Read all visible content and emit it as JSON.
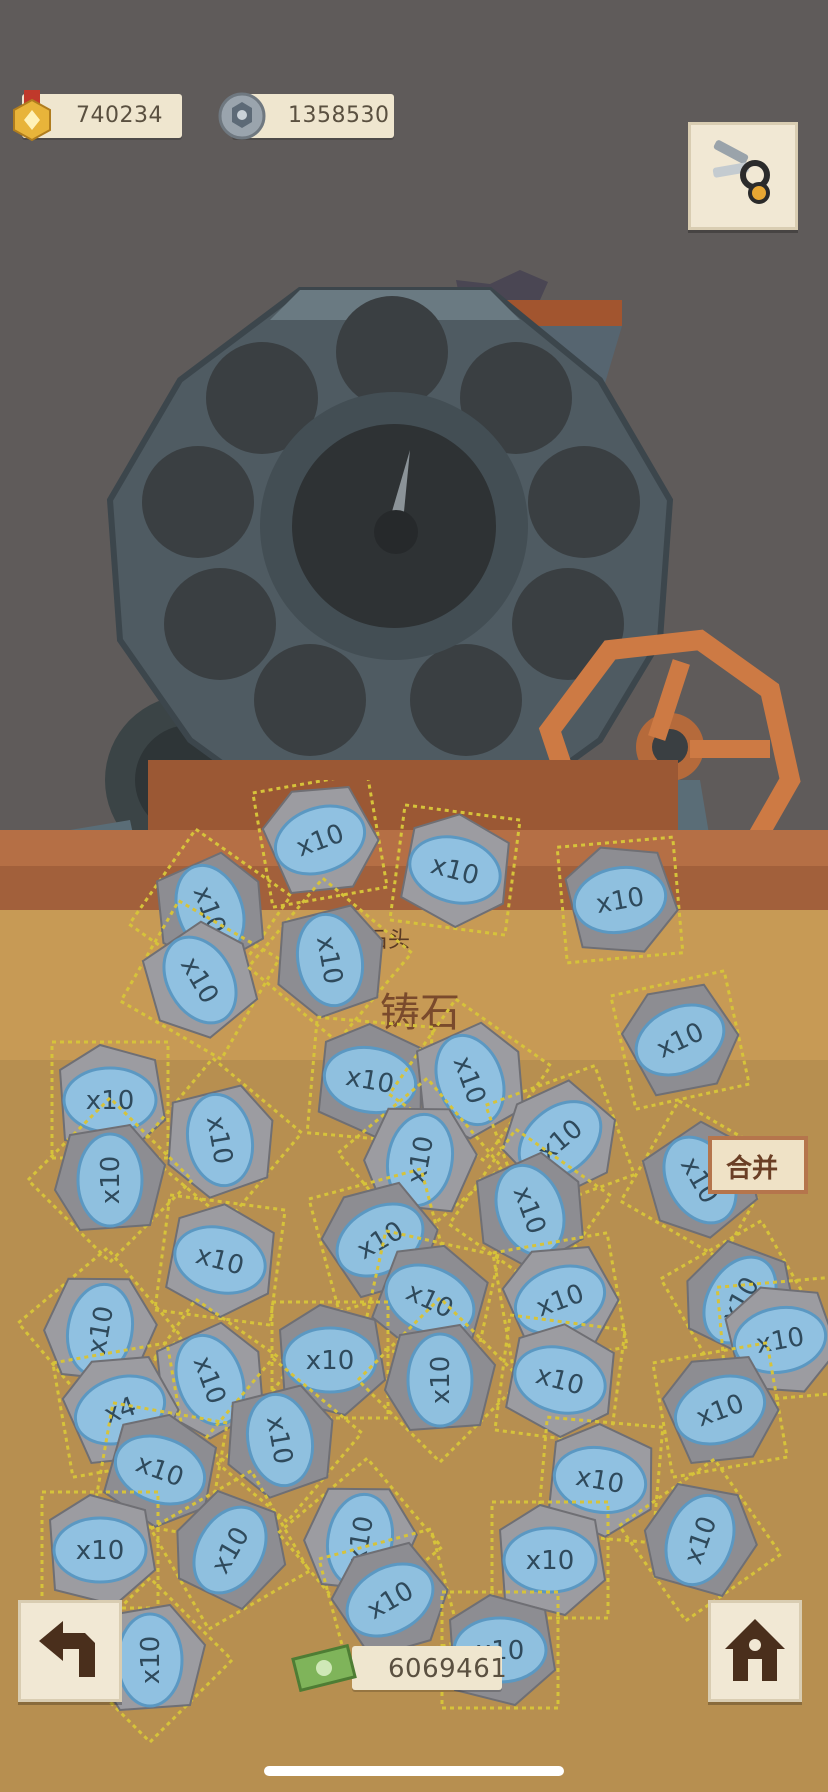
{
  "hud": {
    "medal_value": "740234",
    "nut_value": "1358530",
    "money_value": "6069461"
  },
  "machine": {
    "front_label": "搬石头",
    "plank_label": "铸石"
  },
  "buttons": {
    "merge_label": "合并"
  },
  "stone_badges": [
    "x10",
    "x10",
    "x10",
    "x10",
    "x10",
    "x10",
    "x10",
    "x10",
    "x10",
    "x10",
    "x10",
    "x10",
    "x10",
    "x10",
    "x10",
    "x10",
    "x10",
    "x10",
    "x10",
    "x10",
    "x10",
    "x10",
    "x10",
    "x10",
    "x4",
    "x10",
    "x10",
    "x10",
    "x10",
    "x10",
    "x10",
    "x10",
    "x10",
    "x10",
    "x10",
    "x10",
    "x10",
    "x10",
    "x10",
    "x10"
  ],
  "icons": {
    "medal": "medal-icon",
    "nut": "nut-icon",
    "scissors": "scissors-icon",
    "back": "back-arrow-icon",
    "home": "home-icon",
    "money": "money-icon"
  },
  "colors": {
    "background": "#5f5b5a",
    "stone_badge": "#8fc4e6",
    "plank": "#b56f45",
    "pill": "#efe6cf"
  }
}
